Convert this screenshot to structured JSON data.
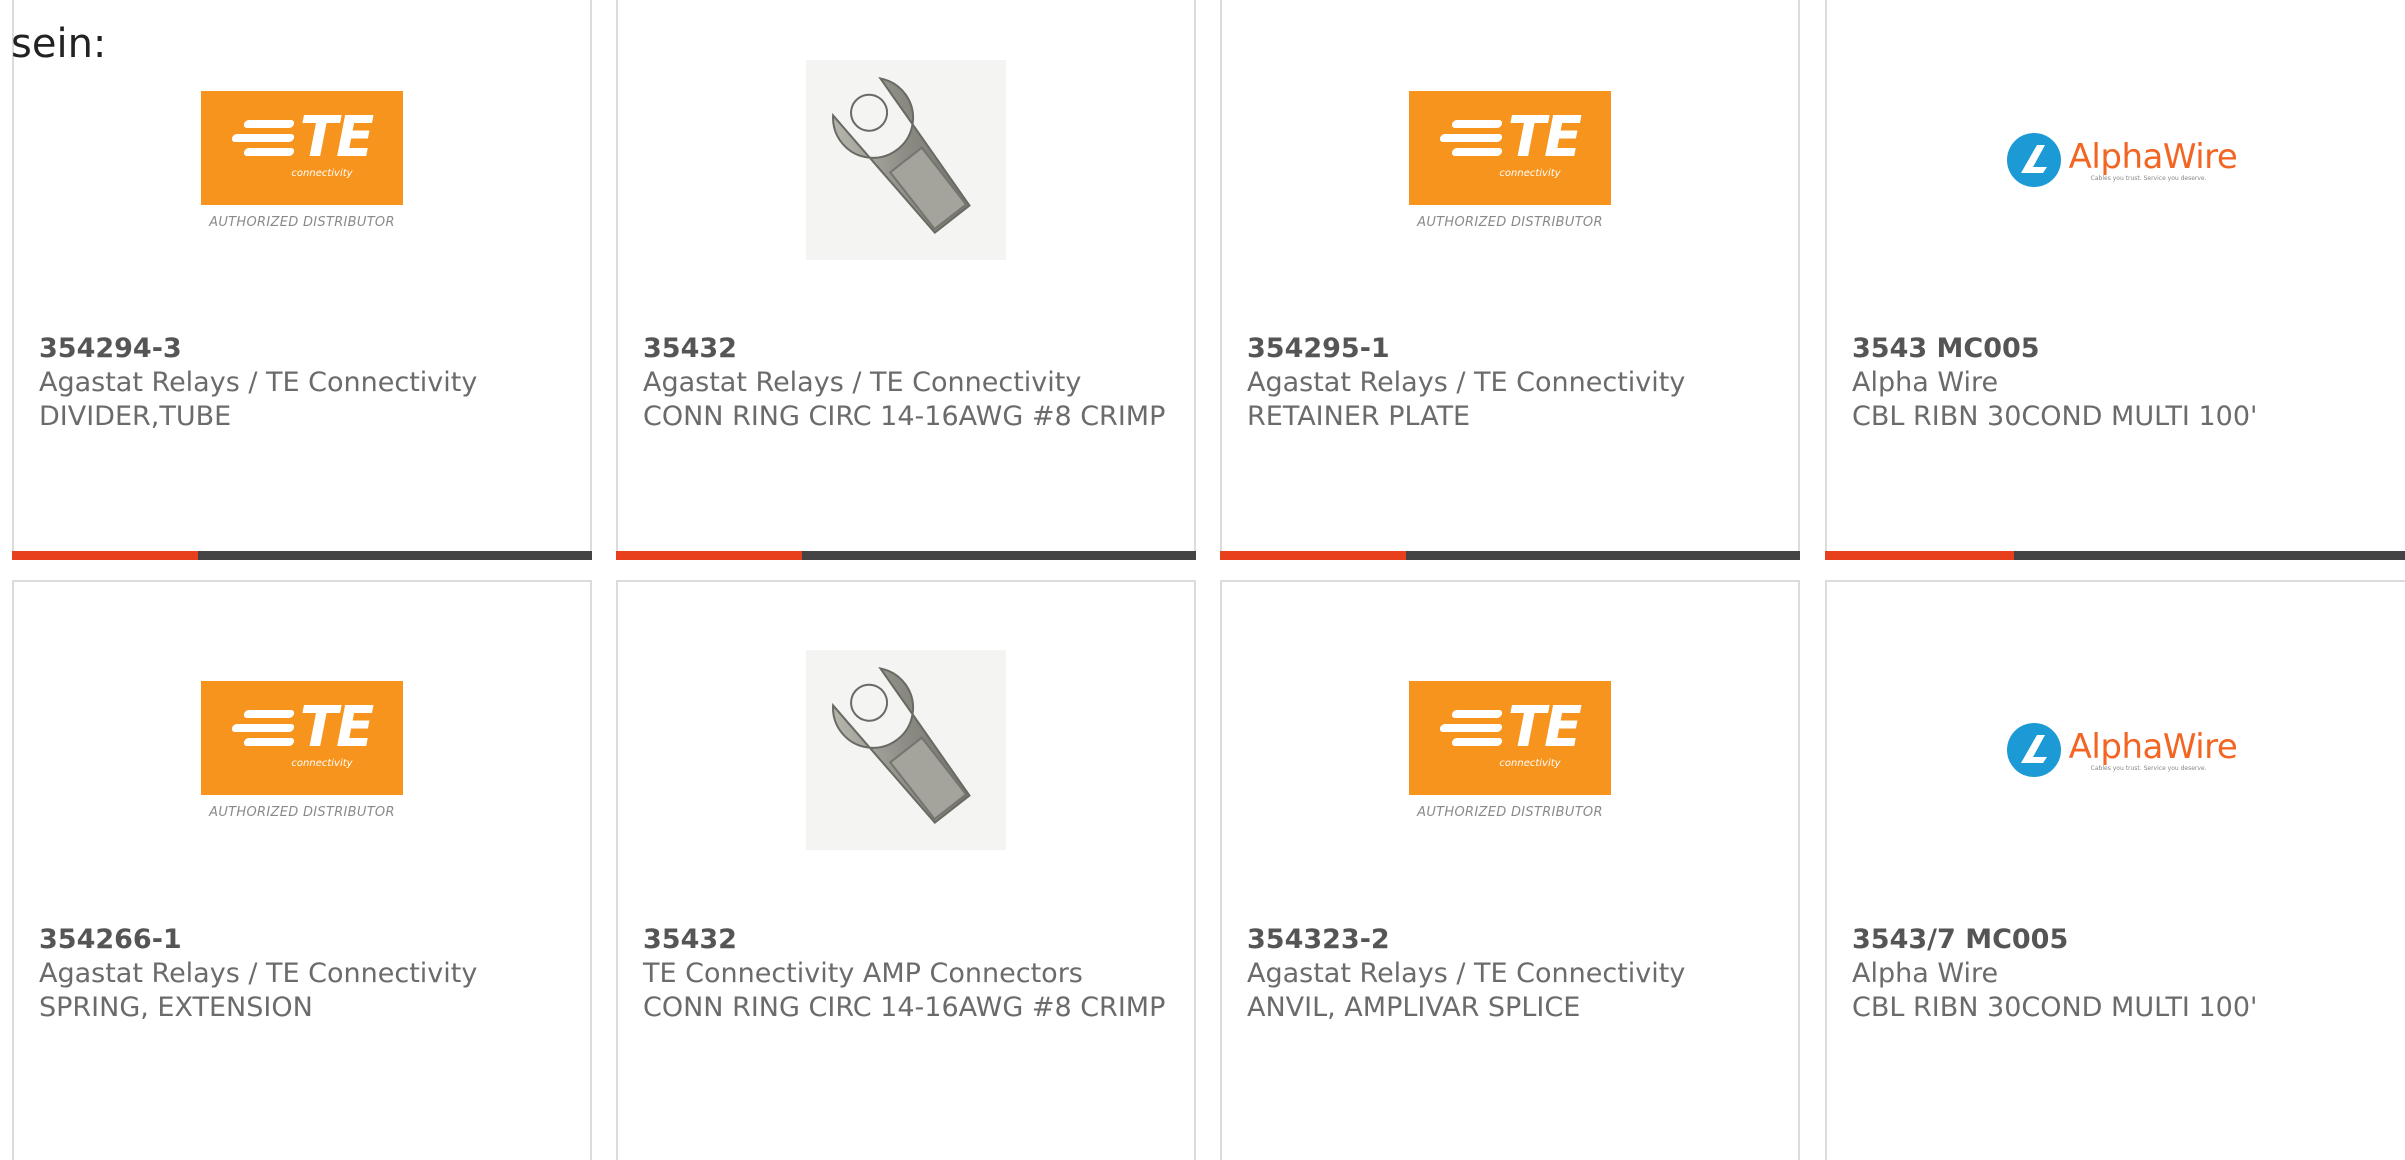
{
  "heading": "sein:",
  "colors": {
    "accent": "#e8401c",
    "bar_track": "#444444",
    "te_orange": "#f7941d",
    "alpha_blue": "#1c9ad6",
    "alpha_orange": "#f26522",
    "text": "#6b6b6b"
  },
  "logos": {
    "te": {
      "letters": "TE",
      "sub": "connectivity",
      "tag": "AUTHORIZED DISTRIBUTOR"
    },
    "alpha": {
      "name": "AlphaWire",
      "tagline": "Cables you trust. Service you deserve."
    }
  },
  "products": [
    {
      "image": "te-connectivity-logo",
      "part": "354294-3",
      "manufacturer": "Agastat Relays / TE Connectivity",
      "description": "DIVIDER,TUBE",
      "progress": 0.32
    },
    {
      "image": "ring-terminal-photo",
      "part": "35432",
      "manufacturer": "Agastat Relays / TE Connectivity",
      "description": "CONN RING CIRC 14-16AWG #8 CRIMP",
      "progress": 0.32
    },
    {
      "image": "te-connectivity-logo",
      "part": "354295-1",
      "manufacturer": "Agastat Relays / TE Connectivity",
      "description": "RETAINER PLATE",
      "progress": 0.32
    },
    {
      "image": "alphawire-logo",
      "part": "3543 MC005",
      "manufacturer": "Alpha Wire",
      "description": "CBL RIBN 30COND MULTI 100'",
      "progress": 0.32
    },
    {
      "image": "te-connectivity-logo",
      "part": "354266-1",
      "manufacturer": "Agastat Relays / TE Connectivity",
      "description": "SPRING, EXTENSION"
    },
    {
      "image": "ring-terminal-photo",
      "part": "35432",
      "manufacturer": "TE Connectivity AMP Connectors",
      "description": "CONN RING CIRC 14-16AWG #8 CRIMP"
    },
    {
      "image": "te-connectivity-logo",
      "part": "354323-2",
      "manufacturer": "Agastat Relays / TE Connectivity",
      "description": "ANVIL, AMPLIVAR SPLICE"
    },
    {
      "image": "alphawire-logo",
      "part": "3543/7 MC005",
      "manufacturer": "Alpha Wire",
      "description": "CBL RIBN 30COND MULTI 100'"
    }
  ]
}
